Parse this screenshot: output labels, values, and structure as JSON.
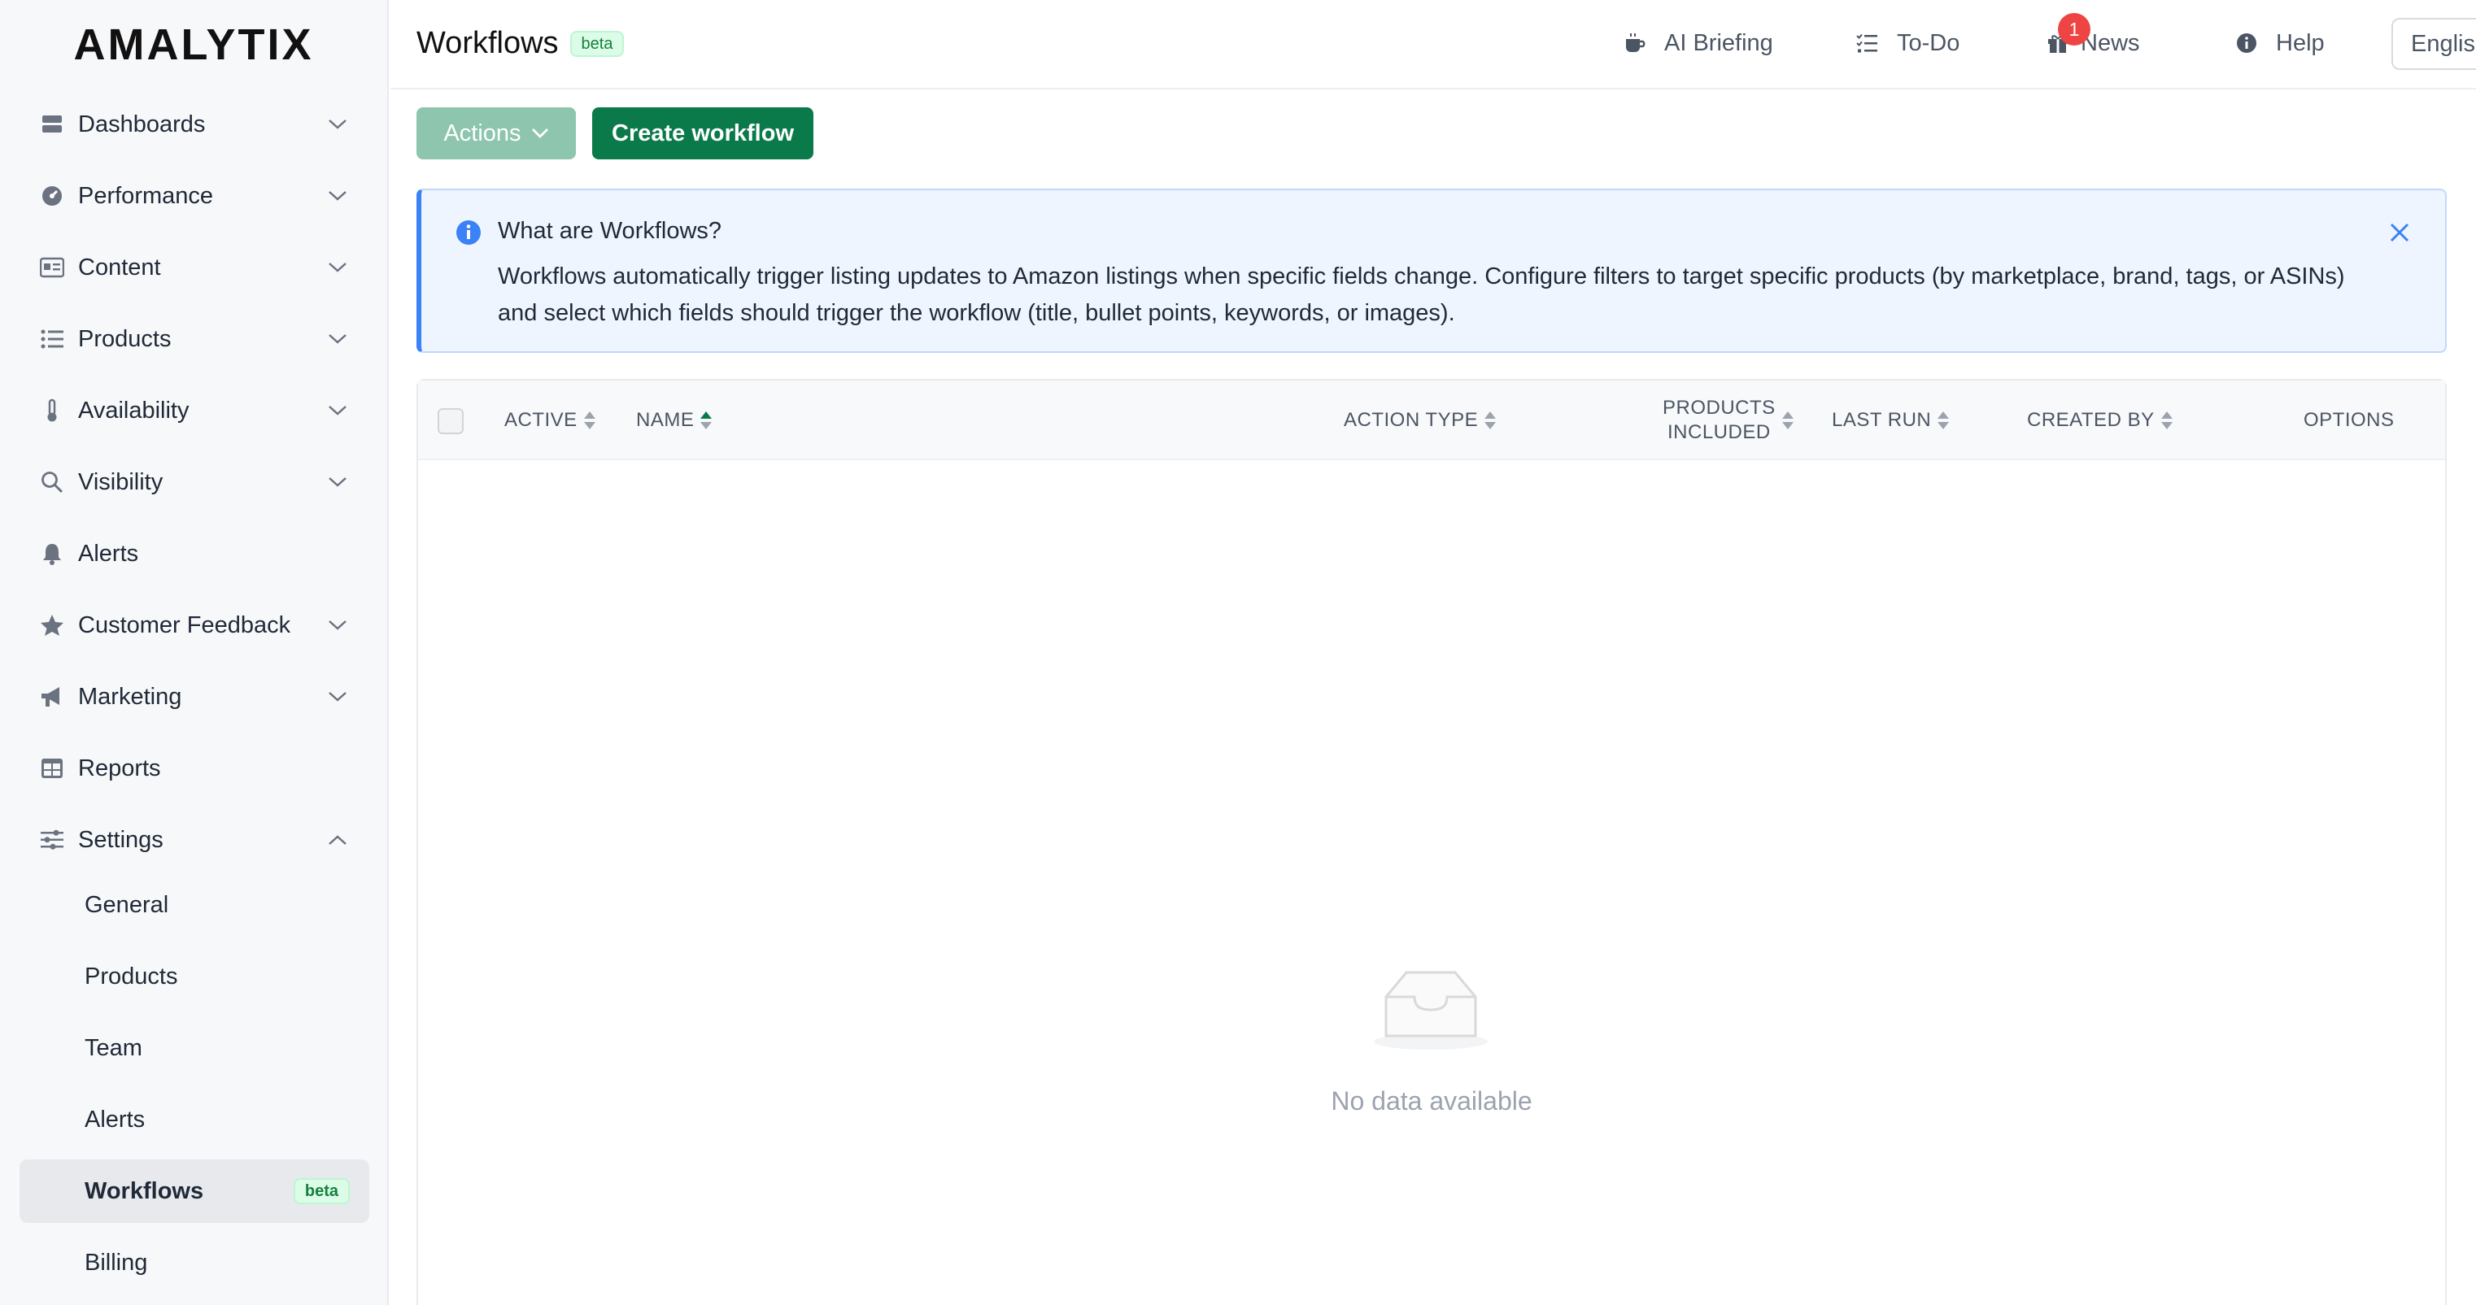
{
  "sidebar": {
    "logo": "AMALYTIX",
    "items": [
      {
        "label": "Dashboards",
        "icon": "dashboard-icon"
      },
      {
        "label": "Performance",
        "icon": "gauge-icon"
      },
      {
        "label": "Content",
        "icon": "content-icon"
      },
      {
        "label": "Products",
        "icon": "list-icon"
      },
      {
        "label": "Availability",
        "icon": "thermometer-icon"
      },
      {
        "label": "Visibility",
        "icon": "search-icon"
      },
      {
        "label": "Alerts",
        "icon": "bell-icon"
      },
      {
        "label": "Customer Feedback",
        "icon": "star-icon"
      },
      {
        "label": "Marketing",
        "icon": "megaphone-icon"
      },
      {
        "label": "Reports",
        "icon": "table-icon"
      },
      {
        "label": "Settings",
        "icon": "sliders-icon"
      }
    ],
    "settings_sub": [
      {
        "label": "General"
      },
      {
        "label": "Products"
      },
      {
        "label": "Team"
      },
      {
        "label": "Alerts"
      },
      {
        "label": "Workflows",
        "badge": "beta"
      },
      {
        "label": "Billing"
      }
    ]
  },
  "header": {
    "title": "Workflows",
    "title_badge": "beta",
    "links": [
      {
        "label": "AI Briefing",
        "icon": "coffee-icon"
      },
      {
        "label": "To-Do",
        "icon": "checklist-icon"
      },
      {
        "label": "News",
        "icon": "gift-icon"
      },
      {
        "label": "Help",
        "icon": "info-icon"
      }
    ],
    "news_badge": "1",
    "language": "English"
  },
  "toolbar": {
    "actions_label": "Actions",
    "create_label": "Create workflow"
  },
  "info": {
    "title": "What are Workflows?",
    "text": "Workflows automatically trigger listing updates to Amazon listings when specific fields change. Configure filters to target specific products (by marketplace, brand, tags, or ASINs) and select which fields should trigger the workflow (title, bullet points, keywords, or images)."
  },
  "table": {
    "columns": {
      "active": "ACTIVE",
      "name": "NAME",
      "action_type": "ACTION TYPE",
      "products_line1": "PRODUCTS",
      "products_line2": "INCLUDED",
      "last_run": "LAST RUN",
      "created_by": "CREATED BY",
      "options": "OPTIONS"
    },
    "empty_text": "No data available"
  },
  "colors": {
    "primary": "#0b7a4b",
    "primary_light": "#8ec5ae",
    "info_accent": "#3b82f6",
    "badge_red": "#ef4444",
    "beta_green": "#15803d"
  }
}
